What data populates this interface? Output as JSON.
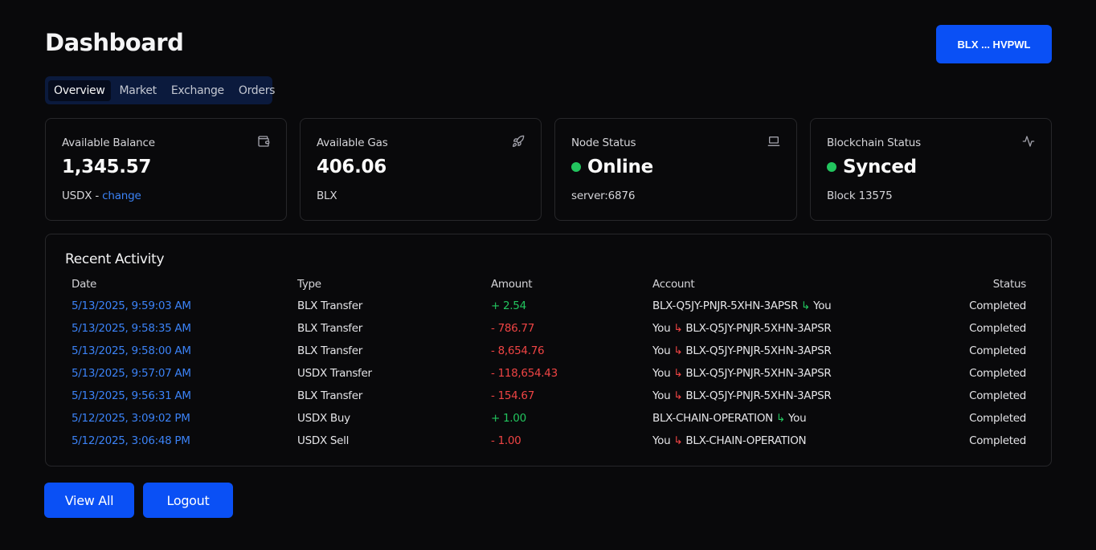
{
  "header": {
    "title": "Dashboard",
    "account_button": "BLX ... HVPWL"
  },
  "tabs": [
    {
      "label": "Overview",
      "active": true
    },
    {
      "label": "Market",
      "active": false
    },
    {
      "label": "Exchange",
      "active": false
    },
    {
      "label": "Orders",
      "active": false
    }
  ],
  "cards": {
    "balance": {
      "label": "Available Balance",
      "value": "1,345.57",
      "sub_prefix": "USDX - ",
      "sub_link": "change",
      "icon": "wallet-icon"
    },
    "gas": {
      "label": "Available Gas",
      "value": "406.06",
      "sub": "BLX",
      "icon": "rocket-icon"
    },
    "node": {
      "label": "Node Status",
      "value": "Online",
      "sub": "server:6876",
      "icon": "laptop-icon",
      "status_color": "#22c55e"
    },
    "chain": {
      "label": "Blockchain Status",
      "value": "Synced",
      "sub": "Block 13575",
      "icon": "activity-icon",
      "status_color": "#22c55e"
    }
  },
  "activity": {
    "title": "Recent Activity",
    "columns": [
      "Date",
      "Type",
      "Amount",
      "Account",
      "Status"
    ],
    "rows": [
      {
        "date": "5/13/2025, 9:59:03 AM",
        "type": "BLX Transfer",
        "amount": "+ 2.54",
        "direction": "in",
        "from": "BLX-Q5JY-PNJR-5XHN-3APSR",
        "to": "You",
        "status": "Completed"
      },
      {
        "date": "5/13/2025, 9:58:35 AM",
        "type": "BLX Transfer",
        "amount": "- 786.77",
        "direction": "out",
        "from": "You",
        "to": "BLX-Q5JY-PNJR-5XHN-3APSR",
        "status": "Completed"
      },
      {
        "date": "5/13/2025, 9:58:00 AM",
        "type": "BLX Transfer",
        "amount": "- 8,654.76",
        "direction": "out",
        "from": "You",
        "to": "BLX-Q5JY-PNJR-5XHN-3APSR",
        "status": "Completed"
      },
      {
        "date": "5/13/2025, 9:57:07 AM",
        "type": "USDX Transfer",
        "amount": "- 118,654.43",
        "direction": "out",
        "from": "You",
        "to": "BLX-Q5JY-PNJR-5XHN-3APSR",
        "status": "Completed"
      },
      {
        "date": "5/13/2025, 9:56:31 AM",
        "type": "BLX Transfer",
        "amount": "- 154.67",
        "direction": "out",
        "from": "You",
        "to": "BLX-Q5JY-PNJR-5XHN-3APSR",
        "status": "Completed"
      },
      {
        "date": "5/12/2025, 3:09:02 PM",
        "type": "USDX Buy",
        "amount": "+ 1.00",
        "direction": "in",
        "from": "BLX-CHAIN-OPERATION",
        "to": "You",
        "status": "Completed"
      },
      {
        "date": "5/12/2025, 3:06:48 PM",
        "type": "USDX Sell",
        "amount": "- 1.00",
        "direction": "out",
        "from": "You",
        "to": "BLX-CHAIN-OPERATION",
        "status": "Completed"
      }
    ],
    "arrow_glyph": "↳"
  },
  "buttons": {
    "view_all": "View All",
    "logout": "Logout"
  },
  "colors": {
    "accent": "#0a50f5",
    "positive": "#22c55e",
    "negative": "#ef4444",
    "link": "#3b82f6",
    "background": "#09090b"
  }
}
